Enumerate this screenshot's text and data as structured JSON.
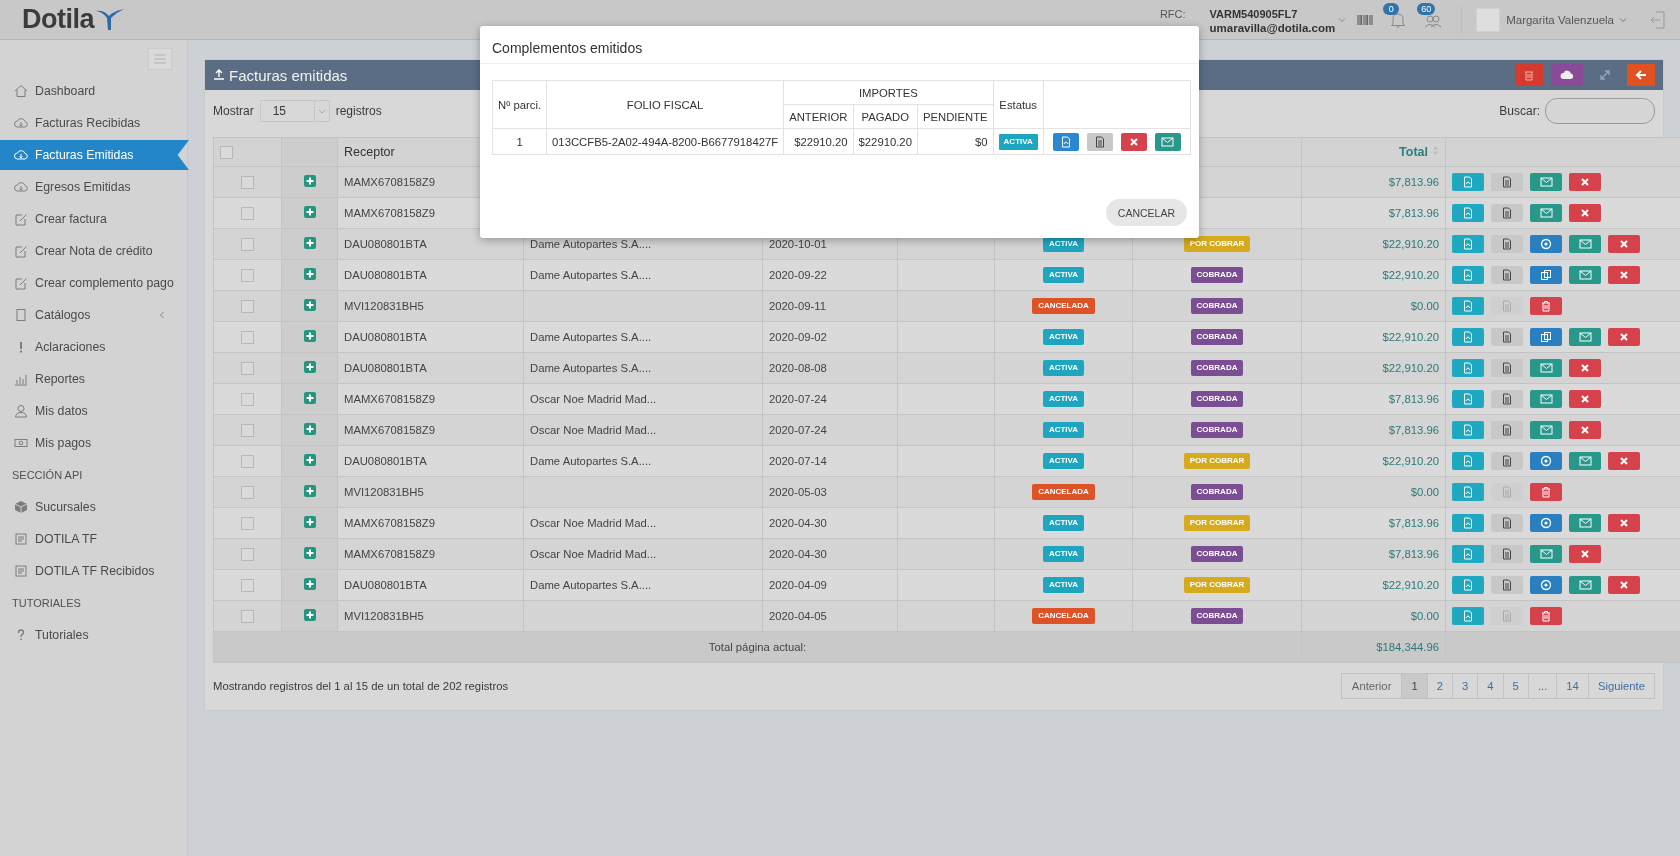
{
  "topbar": {
    "logo": "Dotila",
    "rfc_label": "RFC:",
    "rfc": "VARM540905FL7",
    "email": "umaravilla@dotila.com",
    "notifications": [
      {
        "count": "0"
      },
      {
        "count": "60"
      }
    ],
    "user_name": "Margarita Valenzuela"
  },
  "sidebar": {
    "items": [
      {
        "kind": "link",
        "label": "Dashboard",
        "selected": false
      },
      {
        "kind": "link",
        "label": "Facturas Recibidas",
        "selected": false
      },
      {
        "kind": "link",
        "label": "Facturas Emitidas",
        "selected": true
      },
      {
        "kind": "link",
        "label": "Egresos Emitidas",
        "selected": false
      },
      {
        "kind": "link",
        "label": "Crear factura",
        "selected": false
      },
      {
        "kind": "link",
        "label": "Crear Nota de crédito",
        "selected": false
      },
      {
        "kind": "link",
        "label": "Crear complemento pago",
        "selected": false
      },
      {
        "kind": "group",
        "label": "Catálogos",
        "selected": false,
        "expanded": false
      },
      {
        "kind": "link",
        "label": "Aclaraciones",
        "selected": false
      },
      {
        "kind": "link",
        "label": "Reportes",
        "selected": false
      },
      {
        "kind": "link",
        "label": "Mis datos",
        "selected": false
      },
      {
        "kind": "link",
        "label": "Mis pagos",
        "selected": false
      },
      {
        "kind": "heading",
        "label": "SECCIÓN API"
      },
      {
        "kind": "link",
        "label": "Sucursales",
        "selected": false
      },
      {
        "kind": "link",
        "label": "DOTILA TF",
        "selected": false
      },
      {
        "kind": "link",
        "label": "DOTILA TF Recibidos",
        "selected": false
      },
      {
        "kind": "heading",
        "label": "TUTORIALES"
      },
      {
        "kind": "link",
        "label": "Tutoriales",
        "selected": false
      }
    ]
  },
  "panel": {
    "title": "Facturas emitidas",
    "show_label": "Mostrar",
    "page_size": "15",
    "records_label": "registros",
    "search_label": "Buscar:"
  },
  "table": {
    "header_checked": false,
    "columns": [
      {
        "label": "Receptor",
        "kind": "receptor"
      },
      {
        "label": "Total",
        "kind": "total"
      }
    ],
    "rows": [
      {
        "checked": false,
        "rfc": "MAMX6708158Z9",
        "total": "$7,813.96",
        "actions": [
          {
            "kind": "pdf"
          },
          {
            "kind": "xml"
          },
          {
            "kind": "mail"
          },
          {
            "kind": "cancel"
          }
        ]
      },
      {
        "checked": false,
        "rfc": "MAMX6708158Z9",
        "total": "$7,813.96",
        "actions": [
          {
            "kind": "pdf"
          },
          {
            "kind": "xml"
          },
          {
            "kind": "mail"
          },
          {
            "kind": "cancel"
          }
        ]
      },
      {
        "checked": false,
        "rfc": "DAU080801BTA",
        "name": "Dame Autopartes S.A....",
        "date": "2020-10-01",
        "status": {
          "label": "ACTIVA",
          "kind": "activa"
        },
        "payment": {
          "label": "POR COBRAR",
          "kind": "por_cobrar"
        },
        "total": "$22,910.20",
        "actions": [
          {
            "kind": "pdf"
          },
          {
            "kind": "xml"
          },
          {
            "kind": "pay"
          },
          {
            "kind": "mail"
          },
          {
            "kind": "cancel"
          }
        ]
      },
      {
        "checked": false,
        "rfc": "DAU080801BTA",
        "name": "Dame Autopartes S.A....",
        "date": "2020-09-22",
        "status": {
          "label": "ACTIVA",
          "kind": "activa"
        },
        "payment": {
          "label": "COBRADA",
          "kind": "cobrada"
        },
        "total": "$22,910.20",
        "actions": [
          {
            "kind": "pdf"
          },
          {
            "kind": "xml"
          },
          {
            "kind": "copy"
          },
          {
            "kind": "mail"
          },
          {
            "kind": "cancel"
          }
        ]
      },
      {
        "checked": false,
        "rfc": "MVI120831BH5",
        "date": "2020-09-11",
        "status": {
          "label": "CANCELADA",
          "kind": "cancelada"
        },
        "payment": {
          "label": "COBRADA",
          "kind": "cobrada"
        },
        "total": "$0.00",
        "actions": [
          {
            "kind": "pdf"
          },
          {
            "kind": "xml_disabled"
          },
          {
            "kind": "delete"
          }
        ]
      },
      {
        "checked": false,
        "rfc": "DAU080801BTA",
        "name": "Dame Autopartes S.A....",
        "date": "2020-09-02",
        "status": {
          "label": "ACTIVA",
          "kind": "activa"
        },
        "payment": {
          "label": "COBRADA",
          "kind": "cobrada"
        },
        "total": "$22,910.20",
        "actions": [
          {
            "kind": "pdf"
          },
          {
            "kind": "xml"
          },
          {
            "kind": "copy"
          },
          {
            "kind": "mail"
          },
          {
            "kind": "cancel"
          }
        ]
      },
      {
        "checked": false,
        "rfc": "DAU080801BTA",
        "name": "Dame Autopartes S.A....",
        "date": "2020-08-08",
        "status": {
          "label": "ACTIVA",
          "kind": "activa"
        },
        "payment": {
          "label": "COBRADA",
          "kind": "cobrada"
        },
        "total": "$22,910.20",
        "actions": [
          {
            "kind": "pdf"
          },
          {
            "kind": "xml"
          },
          {
            "kind": "mail"
          },
          {
            "kind": "cancel"
          }
        ]
      },
      {
        "checked": false,
        "rfc": "MAMX6708158Z9",
        "name": "Oscar Noe Madrid Mad...",
        "date": "2020-07-24",
        "status": {
          "label": "ACTIVA",
          "kind": "activa"
        },
        "payment": {
          "label": "COBRADA",
          "kind": "cobrada"
        },
        "total": "$7,813.96",
        "actions": [
          {
            "kind": "pdf"
          },
          {
            "kind": "xml"
          },
          {
            "kind": "mail"
          },
          {
            "kind": "cancel"
          }
        ]
      },
      {
        "checked": false,
        "rfc": "MAMX6708158Z9",
        "name": "Oscar Noe Madrid Mad...",
        "date": "2020-07-24",
        "status": {
          "label": "ACTIVA",
          "kind": "activa"
        },
        "payment": {
          "label": "COBRADA",
          "kind": "cobrada"
        },
        "total": "$7,813.96",
        "actions": [
          {
            "kind": "pdf"
          },
          {
            "kind": "xml"
          },
          {
            "kind": "mail"
          },
          {
            "kind": "cancel"
          }
        ]
      },
      {
        "checked": false,
        "rfc": "DAU080801BTA",
        "name": "Dame Autopartes S.A....",
        "date": "2020-07-14",
        "status": {
          "label": "ACTIVA",
          "kind": "activa"
        },
        "payment": {
          "label": "POR COBRAR",
          "kind": "por_cobrar"
        },
        "total": "$22,910.20",
        "actions": [
          {
            "kind": "pdf"
          },
          {
            "kind": "xml"
          },
          {
            "kind": "pay"
          },
          {
            "kind": "mail"
          },
          {
            "kind": "cancel"
          }
        ]
      },
      {
        "checked": false,
        "rfc": "MVI120831BH5",
        "date": "2020-05-03",
        "status": {
          "label": "CANCELADA",
          "kind": "cancelada"
        },
        "payment": {
          "label": "COBRADA",
          "kind": "cobrada"
        },
        "total": "$0.00",
        "actions": [
          {
            "kind": "pdf"
          },
          {
            "kind": "xml_disabled"
          },
          {
            "kind": "delete"
          }
        ]
      },
      {
        "checked": false,
        "rfc": "MAMX6708158Z9",
        "name": "Oscar Noe Madrid Mad...",
        "date": "2020-04-30",
        "status": {
          "label": "ACTIVA",
          "kind": "activa"
        },
        "payment": {
          "label": "POR COBRAR",
          "kind": "por_cobrar"
        },
        "total": "$7,813.96",
        "actions": [
          {
            "kind": "pdf"
          },
          {
            "kind": "xml"
          },
          {
            "kind": "pay"
          },
          {
            "kind": "mail"
          },
          {
            "kind": "cancel"
          }
        ]
      },
      {
        "checked": false,
        "rfc": "MAMX6708158Z9",
        "name": "Oscar Noe Madrid Mad...",
        "date": "2020-04-30",
        "status": {
          "label": "ACTIVA",
          "kind": "activa"
        },
        "payment": {
          "label": "COBRADA",
          "kind": "cobrada"
        },
        "total": "$7,813.96",
        "actions": [
          {
            "kind": "pdf"
          },
          {
            "kind": "xml"
          },
          {
            "kind": "mail"
          },
          {
            "kind": "cancel"
          }
        ]
      },
      {
        "checked": false,
        "rfc": "DAU080801BTA",
        "name": "Dame Autopartes S.A....",
        "date": "2020-04-09",
        "status": {
          "label": "ACTIVA",
          "kind": "activa"
        },
        "payment": {
          "label": "POR COBRAR",
          "kind": "por_cobrar"
        },
        "total": "$22,910.20",
        "actions": [
          {
            "kind": "pdf"
          },
          {
            "kind": "xml"
          },
          {
            "kind": "pay"
          },
          {
            "kind": "mail"
          },
          {
            "kind": "cancel"
          }
        ]
      },
      {
        "checked": false,
        "rfc": "MVI120831BH5",
        "date": "2020-04-05",
        "status": {
          "label": "CANCELADA",
          "kind": "cancelada"
        },
        "payment": {
          "label": "COBRADA",
          "kind": "cobrada"
        },
        "total": "$0.00",
        "actions": [
          {
            "kind": "pdf"
          },
          {
            "kind": "xml_disabled"
          },
          {
            "kind": "delete"
          }
        ]
      }
    ],
    "total_label": "Total página actual:",
    "total_value": "$184,344.96"
  },
  "footer": {
    "info": "Mostrando registros del 1 al 15 de un total de 202 registros",
    "pages": [
      {
        "label": "Anterior",
        "selected": false
      },
      {
        "label": "1",
        "selected": true
      },
      {
        "label": "2",
        "selected": false
      },
      {
        "label": "3",
        "selected": false
      },
      {
        "label": "4",
        "selected": false
      },
      {
        "label": "5",
        "selected": false
      },
      {
        "label": "...",
        "selected": false
      },
      {
        "label": "14",
        "selected": false
      },
      {
        "label": "Siguiente",
        "selected": false
      }
    ]
  },
  "modal": {
    "title": "Complementos emitidos",
    "headers": {
      "number": "Nº parci.",
      "folio": "FOLIO FISCAL",
      "amounts": "IMPORTES",
      "previous": "ANTERIOR",
      "paid": "PAGADO",
      "pending": "PENDIENTE",
      "status": "Estatus"
    },
    "rows": [
      {
        "number": "1",
        "folio": "013CCFB5-2A02-494A-8200-B6677918427F",
        "previous": "$22910.20",
        "paid": "$22910.20",
        "pending": "$0",
        "status": {
          "label": "ACTIVA",
          "kind": "activa"
        },
        "actions": [
          {
            "kind": "pdf_blue"
          },
          {
            "kind": "xml"
          },
          {
            "kind": "cancel"
          },
          {
            "kind": "mail"
          }
        ]
      }
    ],
    "cancel_button": "CANCELAR"
  }
}
